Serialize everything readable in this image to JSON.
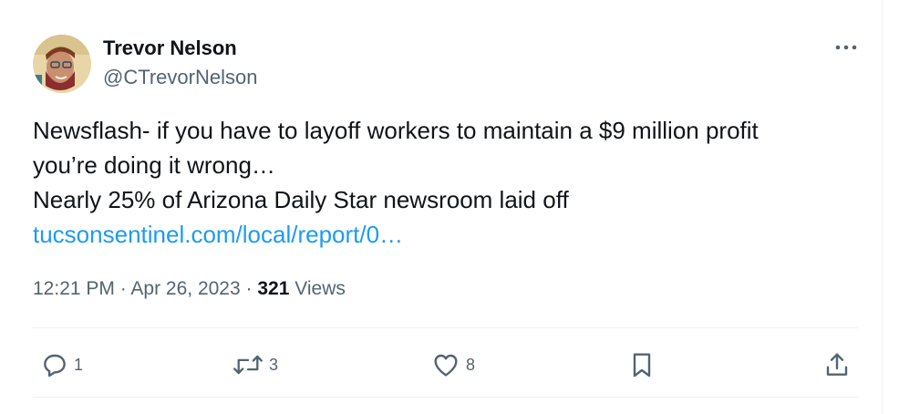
{
  "tweet": {
    "author_name": "Trevor Nelson",
    "author_handle": "@CTrevorNelson",
    "more_icon": "more-horizontal-icon",
    "text_lines": [
      "Newsflash- if you have to layoff workers to maintain a $9 million profit",
      "you’re doing it wrong…",
      "Nearly 25% of Arizona Daily Star newsroom laid off"
    ],
    "link_text": "tucsonsentinel.com/local/report/0…",
    "time": "12:21 PM",
    "separator": "·",
    "date": "Apr 26, 2023",
    "views_count": "321",
    "views_label": "Views"
  },
  "actions": {
    "reply": {
      "icon": "reply-icon",
      "count": "1"
    },
    "retweet": {
      "icon": "retweet-icon",
      "count": "3"
    },
    "like": {
      "icon": "heart-icon",
      "count": "8"
    },
    "bookmark": {
      "icon": "bookmark-icon"
    },
    "share": {
      "icon": "share-icon"
    }
  },
  "colors": {
    "text": "#0f1419",
    "secondary": "#536471",
    "link": "#1d9bf0",
    "divider": "#eff3f4"
  }
}
